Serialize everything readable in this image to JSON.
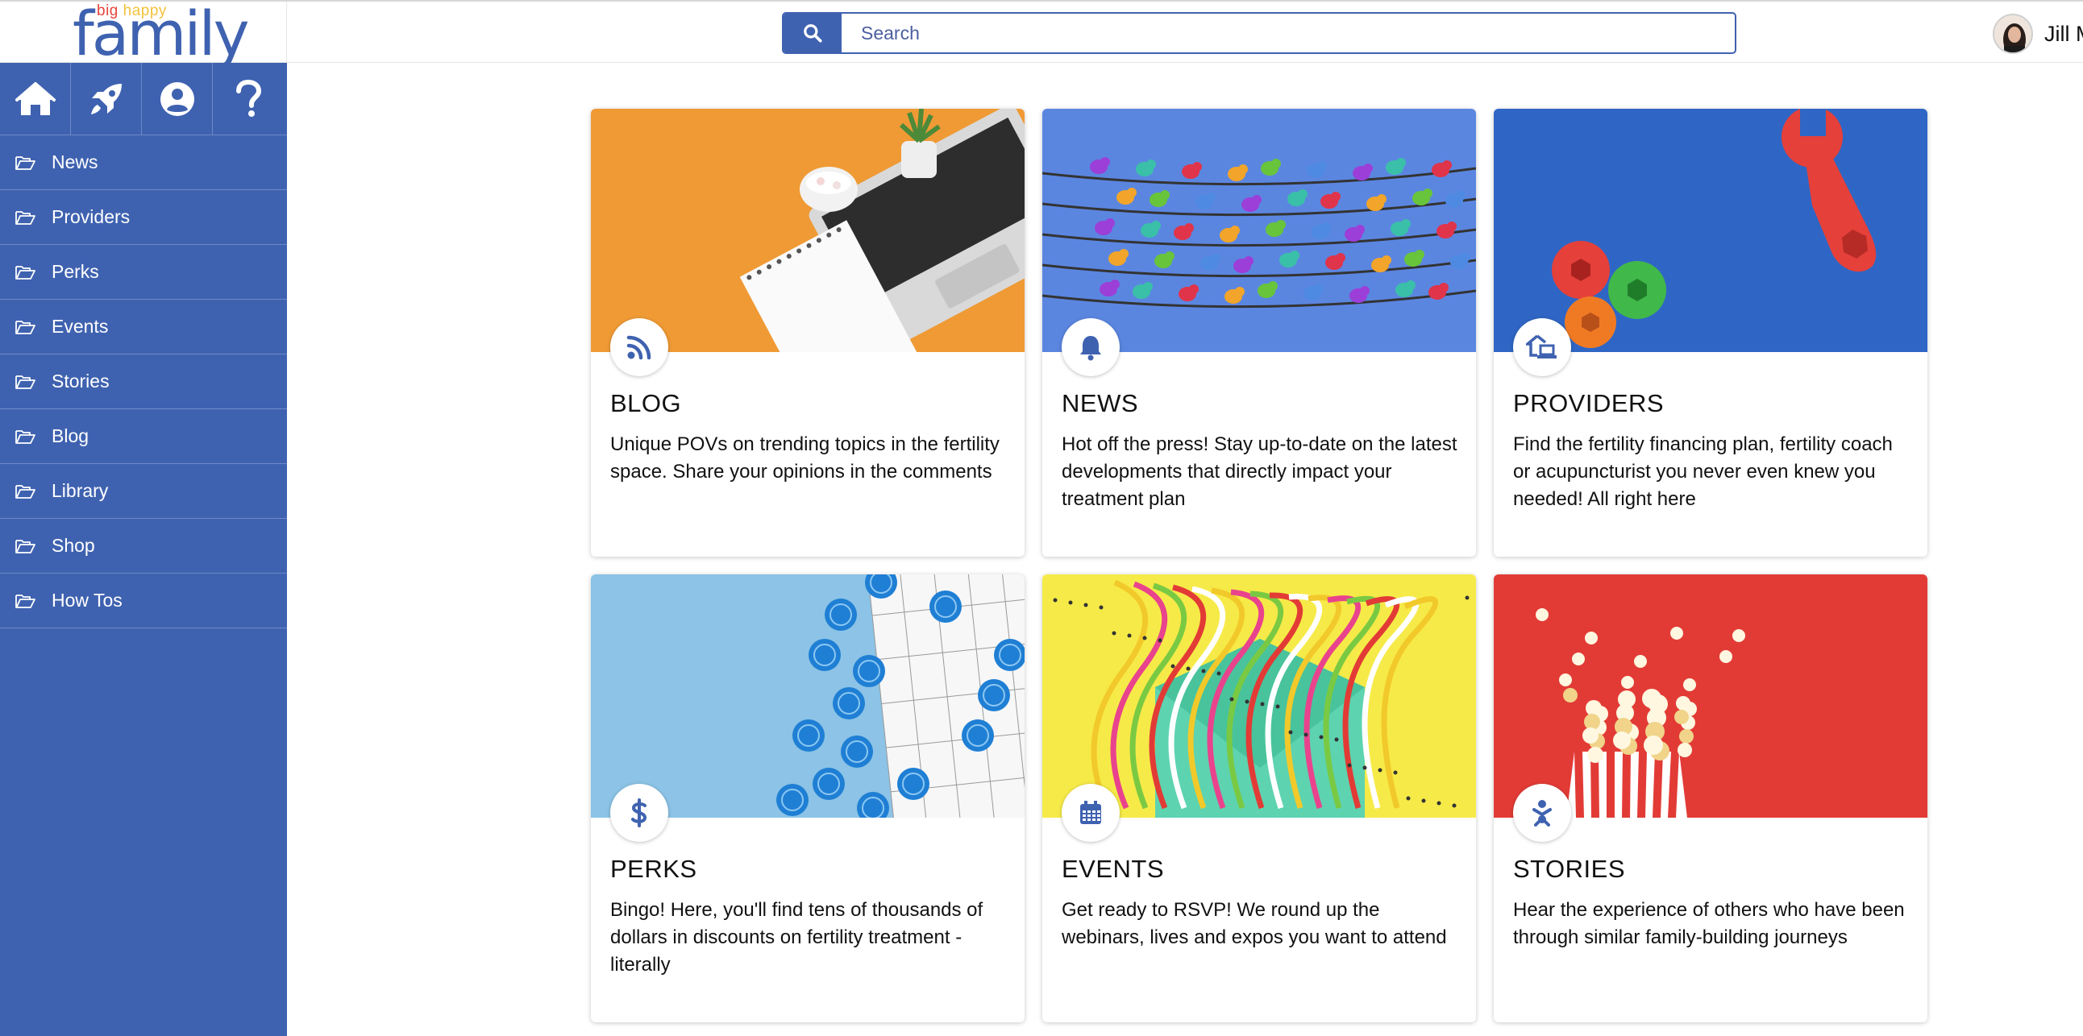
{
  "app": {
    "logo": {
      "small_word1": "big",
      "small_word2": "happy",
      "main": "family"
    }
  },
  "search": {
    "placeholder": "Search",
    "value": ""
  },
  "user": {
    "name": "Jill M"
  },
  "sidebar": {
    "icons": [
      {
        "name": "home-icon"
      },
      {
        "name": "rocket-icon"
      },
      {
        "name": "user-circle-icon"
      },
      {
        "name": "question-icon"
      }
    ],
    "items": [
      {
        "label": "News"
      },
      {
        "label": "Providers"
      },
      {
        "label": "Perks"
      },
      {
        "label": "Events"
      },
      {
        "label": "Stories"
      },
      {
        "label": "Blog"
      },
      {
        "label": "Library"
      },
      {
        "label": "Shop"
      },
      {
        "label": "How Tos"
      }
    ]
  },
  "cards": [
    {
      "title": "BLOG",
      "icon": "rss-icon",
      "description": "Unique POVs on trending topics in the fertility space. Share your opinions in the comments"
    },
    {
      "title": "NEWS",
      "icon": "bell-icon",
      "description": "Hot off the press! Stay up-to-date on the latest developments that directly impact your treatment plan"
    },
    {
      "title": "PROVIDERS",
      "icon": "home-laptop-icon",
      "description": "Find the fertility financing plan, fertility coach or acupuncturist you never even knew you needed! All right here"
    },
    {
      "title": "PERKS",
      "icon": "dollar-icon",
      "description": "Bingo! Here, you'll find tens of thousands of dollars in discounts on fertility treatment - literally"
    },
    {
      "title": "EVENTS",
      "icon": "calendar-icon",
      "description": "Get ready to RSVP! We round up the webinars, lives and expos you want to attend"
    },
    {
      "title": "STORIES",
      "icon": "baby-icon",
      "description": "Hear the experience of others who have been through similar family-building journeys"
    }
  ],
  "colors": {
    "brand": "#3f62b0",
    "blog_bg": "#ef9a35",
    "news_bg": "#5b86e0",
    "providers_bg": "#2f66c5",
    "perks_bg": "#8cc3e6",
    "events_bg": "#f6ea48",
    "stories_bg": "#e23b36"
  }
}
